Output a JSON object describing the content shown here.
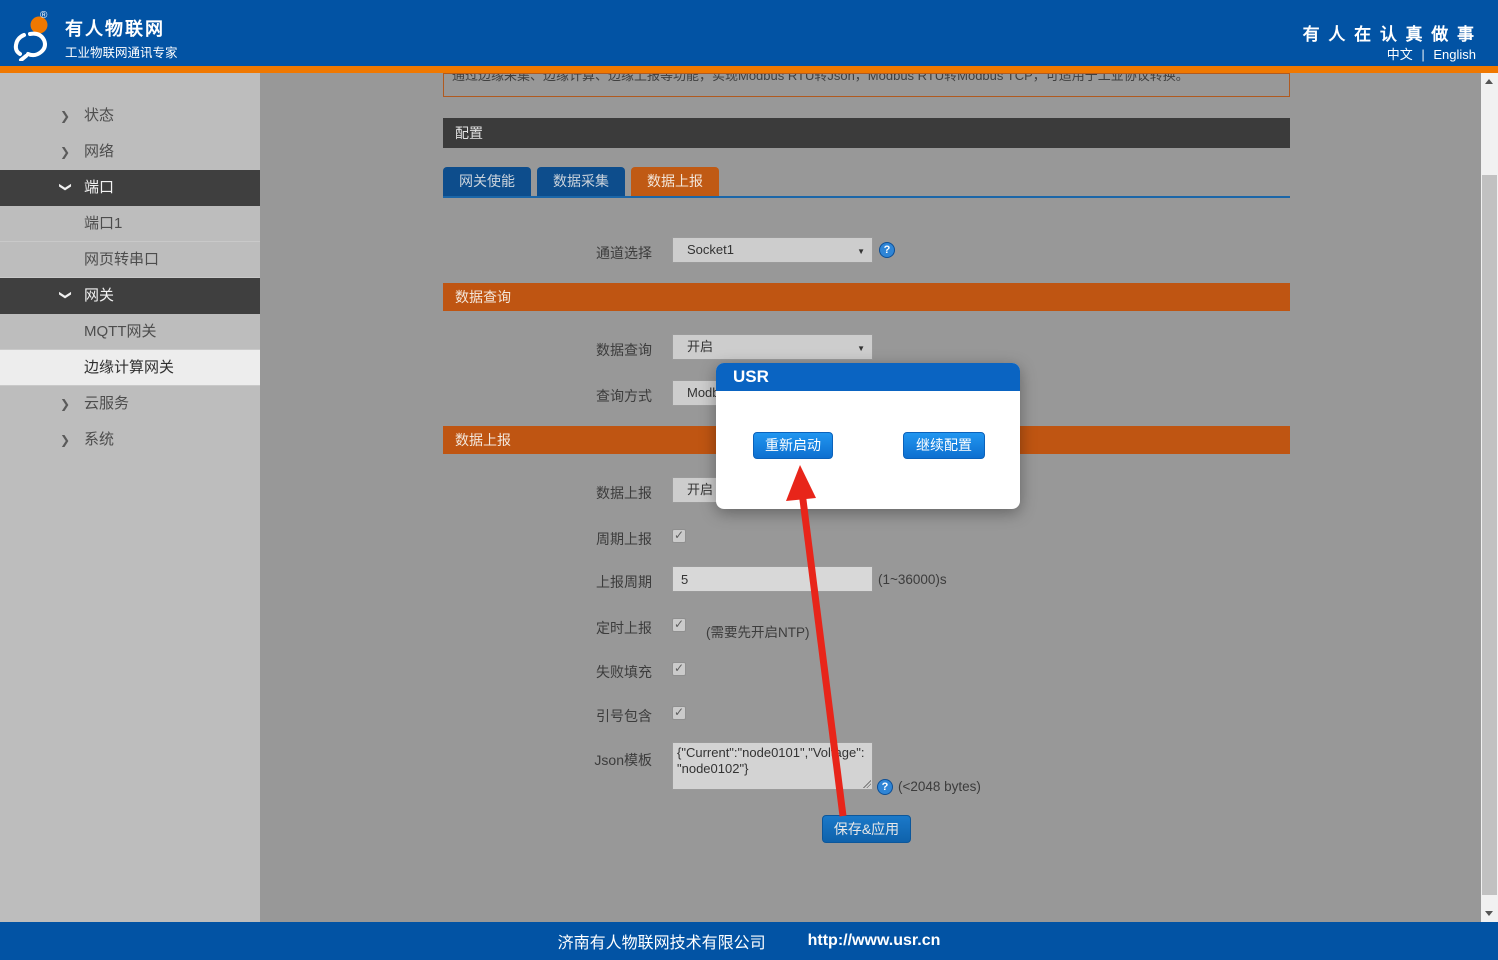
{
  "header": {
    "brand_title": "有人物联网",
    "brand_subtitle": "工业物联网通讯专家",
    "reg_mark": "®",
    "slogan": "有 人 在 认 真 做 事",
    "lang_zh": "中文",
    "lang_sep": "|",
    "lang_en": "English"
  },
  "sidebar": {
    "items": [
      {
        "label": "状态",
        "type": "parent",
        "expanded": false
      },
      {
        "label": "网络",
        "type": "parent",
        "expanded": false
      },
      {
        "label": "端口",
        "type": "parent",
        "expanded": true
      },
      {
        "label": "端口1",
        "type": "sub",
        "selected": false
      },
      {
        "label": "网页转串口",
        "type": "sub",
        "selected": false
      },
      {
        "label": "网关",
        "type": "parent",
        "expanded": true
      },
      {
        "label": "MQTT网关",
        "type": "sub",
        "selected": false
      },
      {
        "label": "边缘计算网关",
        "type": "sub",
        "selected": true
      },
      {
        "label": "云服务",
        "type": "parent",
        "expanded": false
      },
      {
        "label": "系统",
        "type": "parent",
        "expanded": false
      }
    ]
  },
  "content": {
    "intro_text": "通过边缘采集、边缘计算、边缘上报等功能，实现Modbus RTU转Json，Modbus RTU转Modbus TCP，可适用于工业协议转换。",
    "config_bar": "配置",
    "tabs": [
      {
        "label": "网关使能",
        "active": false
      },
      {
        "label": "数据采集",
        "active": false
      },
      {
        "label": "数据上报",
        "active": true
      }
    ],
    "form": {
      "channel_label": "通道选择",
      "channel_value": "Socket1",
      "query_section": "数据查询",
      "query_label": "数据查询",
      "query_value": "开启",
      "query_mode_label": "查询方式",
      "query_mode_value": "Modbus",
      "report_section": "数据上报",
      "report_label": "数据上报",
      "report_value": "开启",
      "cycle_label": "周期上报",
      "cycle_checked": true,
      "period_label": "上报周期",
      "period_value": "5",
      "period_hint": "(1~36000)s",
      "timed_label": "定时上报",
      "timed_checked": true,
      "timed_hint": "(需要先开启NTP)",
      "fail_label": "失败填充",
      "fail_checked": true,
      "quote_label": "引号包含",
      "quote_checked": true,
      "json_label": "Json模板",
      "json_value": "{\"Current\":\"node0101\",\"Voltage\":\"node0102\"}",
      "json_hint": "(<2048 bytes)",
      "save_label": "保存&应用"
    }
  },
  "modal": {
    "title": "USR",
    "restart_label": "重新启动",
    "continue_label": "继续配置"
  },
  "footer": {
    "company": "济南有人物联网技术有限公司",
    "url": "http://www.usr.cn"
  },
  "colors": {
    "header_blue": "#0253a4",
    "accent_orange": "#f07800",
    "section_orange": "#bf5512",
    "active_tab_orange": "#c05a14",
    "inactive_tab_blue": "#0d4d8c",
    "modal_title_blue": "#0a64c2",
    "button_blue": "#1285e0",
    "arrow_red": "#e8251a"
  }
}
